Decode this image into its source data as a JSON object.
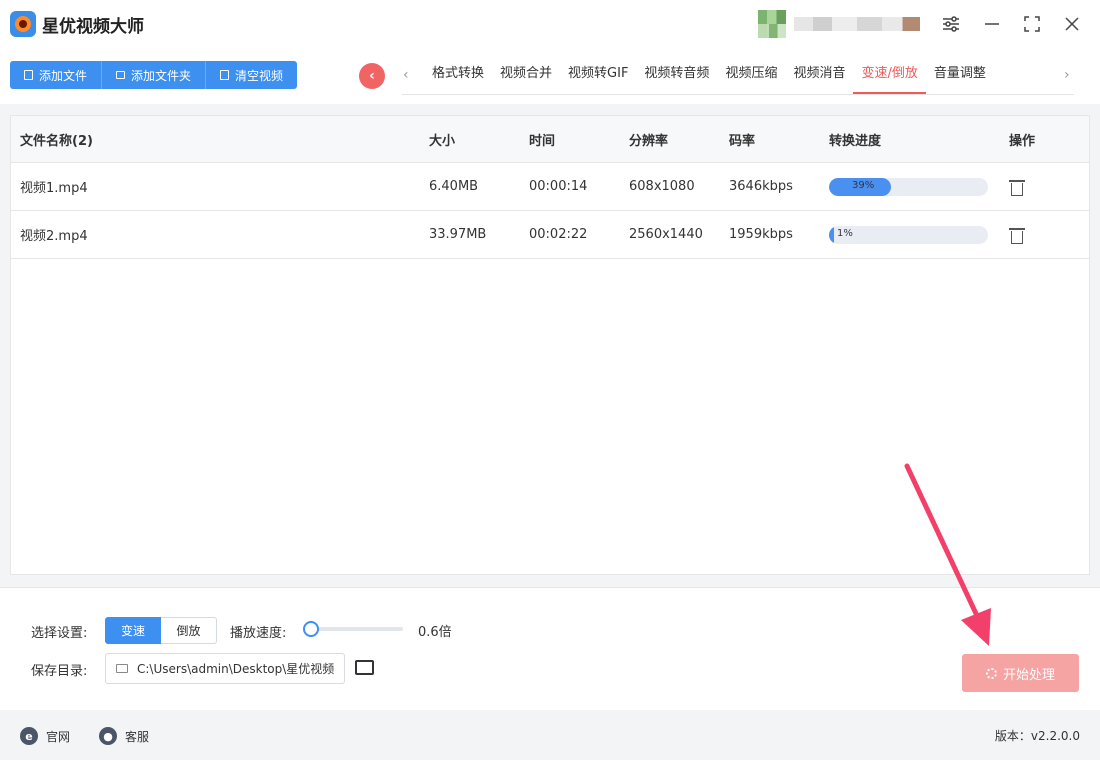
{
  "app": {
    "title": "星优视频大师"
  },
  "toolbar": {
    "add_file": "添加文件",
    "add_folder": "添加文件夹",
    "clear_videos": "清空视频"
  },
  "tabs": [
    "格式转换",
    "视频合并",
    "视频转GIF",
    "视频转音频",
    "视频压缩",
    "视频消音",
    "变速/倒放",
    "音量调整"
  ],
  "active_tab": "变速/倒放",
  "table": {
    "headers": {
      "name": "文件名称(2)",
      "size": "大小",
      "time": "时间",
      "resolution": "分辨率",
      "bitrate": "码率",
      "progress": "转换进度",
      "action": "操作"
    },
    "rows": [
      {
        "name": "视频1.mp4",
        "size": "6.40MB",
        "time": "00:00:14",
        "resolution": "608x1080",
        "bitrate": "3646kbps",
        "progress_label": "39%",
        "progress": 0.39
      },
      {
        "name": "视频2.mp4",
        "size": "33.97MB",
        "time": "00:02:22",
        "resolution": "2560x1440",
        "bitrate": "1959kbps",
        "progress_label": "1%",
        "progress": 0.01
      }
    ]
  },
  "settings": {
    "mode_label": "选择设置:",
    "mode_speed": "变速",
    "mode_reverse": "倒放",
    "speed_label": "播放速度:",
    "speed_value": "0.6倍",
    "save_label": "保存目录:",
    "save_path": "C:\\Users\\admin\\Desktop\\星优视频",
    "start_button": "开始处理"
  },
  "status": {
    "website": "官网",
    "support": "客服",
    "version": "版本：v2.2.0.0"
  },
  "colors": {
    "accent_blue": "#3d8ff0",
    "accent_red": "#f05a5a",
    "start_disabled": "#f5a3a3"
  }
}
